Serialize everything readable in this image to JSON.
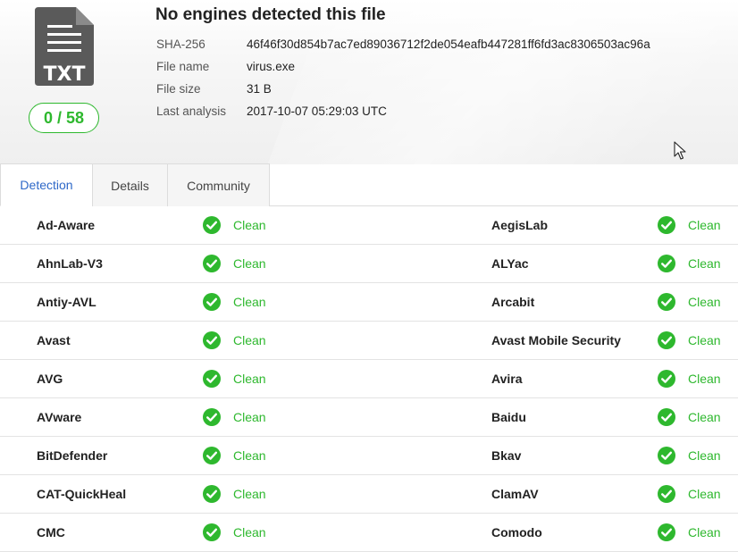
{
  "file": {
    "type_label": "TXT",
    "score": "0 / 58",
    "title": "No engines detected this file",
    "meta": [
      {
        "key": "SHA-256",
        "value": "46f46f30d854b7ac7ed89036712f2de054eafb447281ff6fd3ac8306503ac96a"
      },
      {
        "key": "File name",
        "value": "virus.exe"
      },
      {
        "key": "File size",
        "value": "31 B"
      },
      {
        "key": "Last analysis",
        "value": "2017-10-07 05:29:03 UTC"
      }
    ]
  },
  "tabs": [
    {
      "label": "Detection",
      "active": true
    },
    {
      "label": "Details",
      "active": false
    },
    {
      "label": "Community",
      "active": false
    }
  ],
  "colors": {
    "clean": "#2eb82e",
    "active_tab": "#2e68c8"
  },
  "icons": {
    "file": "txt-file-icon",
    "status": "check-circle-icon",
    "cursor": "mouse-pointer-icon"
  },
  "results": [
    {
      "left": {
        "engine": "Ad-Aware",
        "result": "Clean"
      },
      "right": {
        "engine": "AegisLab",
        "result": "Clean"
      }
    },
    {
      "left": {
        "engine": "AhnLab-V3",
        "result": "Clean"
      },
      "right": {
        "engine": "ALYac",
        "result": "Clean"
      }
    },
    {
      "left": {
        "engine": "Antiy-AVL",
        "result": "Clean"
      },
      "right": {
        "engine": "Arcabit",
        "result": "Clean"
      }
    },
    {
      "left": {
        "engine": "Avast",
        "result": "Clean"
      },
      "right": {
        "engine": "Avast Mobile Security",
        "result": "Clean"
      }
    },
    {
      "left": {
        "engine": "AVG",
        "result": "Clean"
      },
      "right": {
        "engine": "Avira",
        "result": "Clean"
      }
    },
    {
      "left": {
        "engine": "AVware",
        "result": "Clean"
      },
      "right": {
        "engine": "Baidu",
        "result": "Clean"
      }
    },
    {
      "left": {
        "engine": "BitDefender",
        "result": "Clean"
      },
      "right": {
        "engine": "Bkav",
        "result": "Clean"
      }
    },
    {
      "left": {
        "engine": "CAT-QuickHeal",
        "result": "Clean"
      },
      "right": {
        "engine": "ClamAV",
        "result": "Clean"
      }
    },
    {
      "left": {
        "engine": "CMC",
        "result": "Clean"
      },
      "right": {
        "engine": "Comodo",
        "result": "Clean"
      }
    }
  ]
}
